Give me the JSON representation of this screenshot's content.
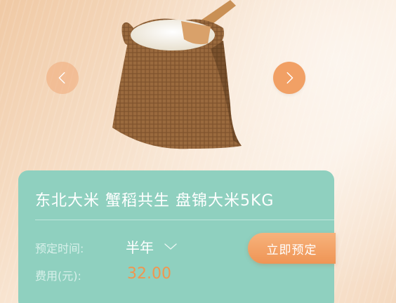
{
  "product": {
    "title": "东北大米 蟹稻共生 盘锦大米5KG",
    "image_icon": "rice-sack-with-scoop"
  },
  "carousel": {
    "prev_icon": "chevron-left-icon",
    "next_icon": "chevron-right-icon"
  },
  "order": {
    "time_label": "预定时间:",
    "time_value": "半年",
    "fee_label": "费用(元):",
    "price": "32.00",
    "reserve_label": "立即预定"
  },
  "colors": {
    "card": "#8fd0bf",
    "accent": "#ef9555",
    "price": "#f0964f",
    "background": "#f6dcc2"
  }
}
